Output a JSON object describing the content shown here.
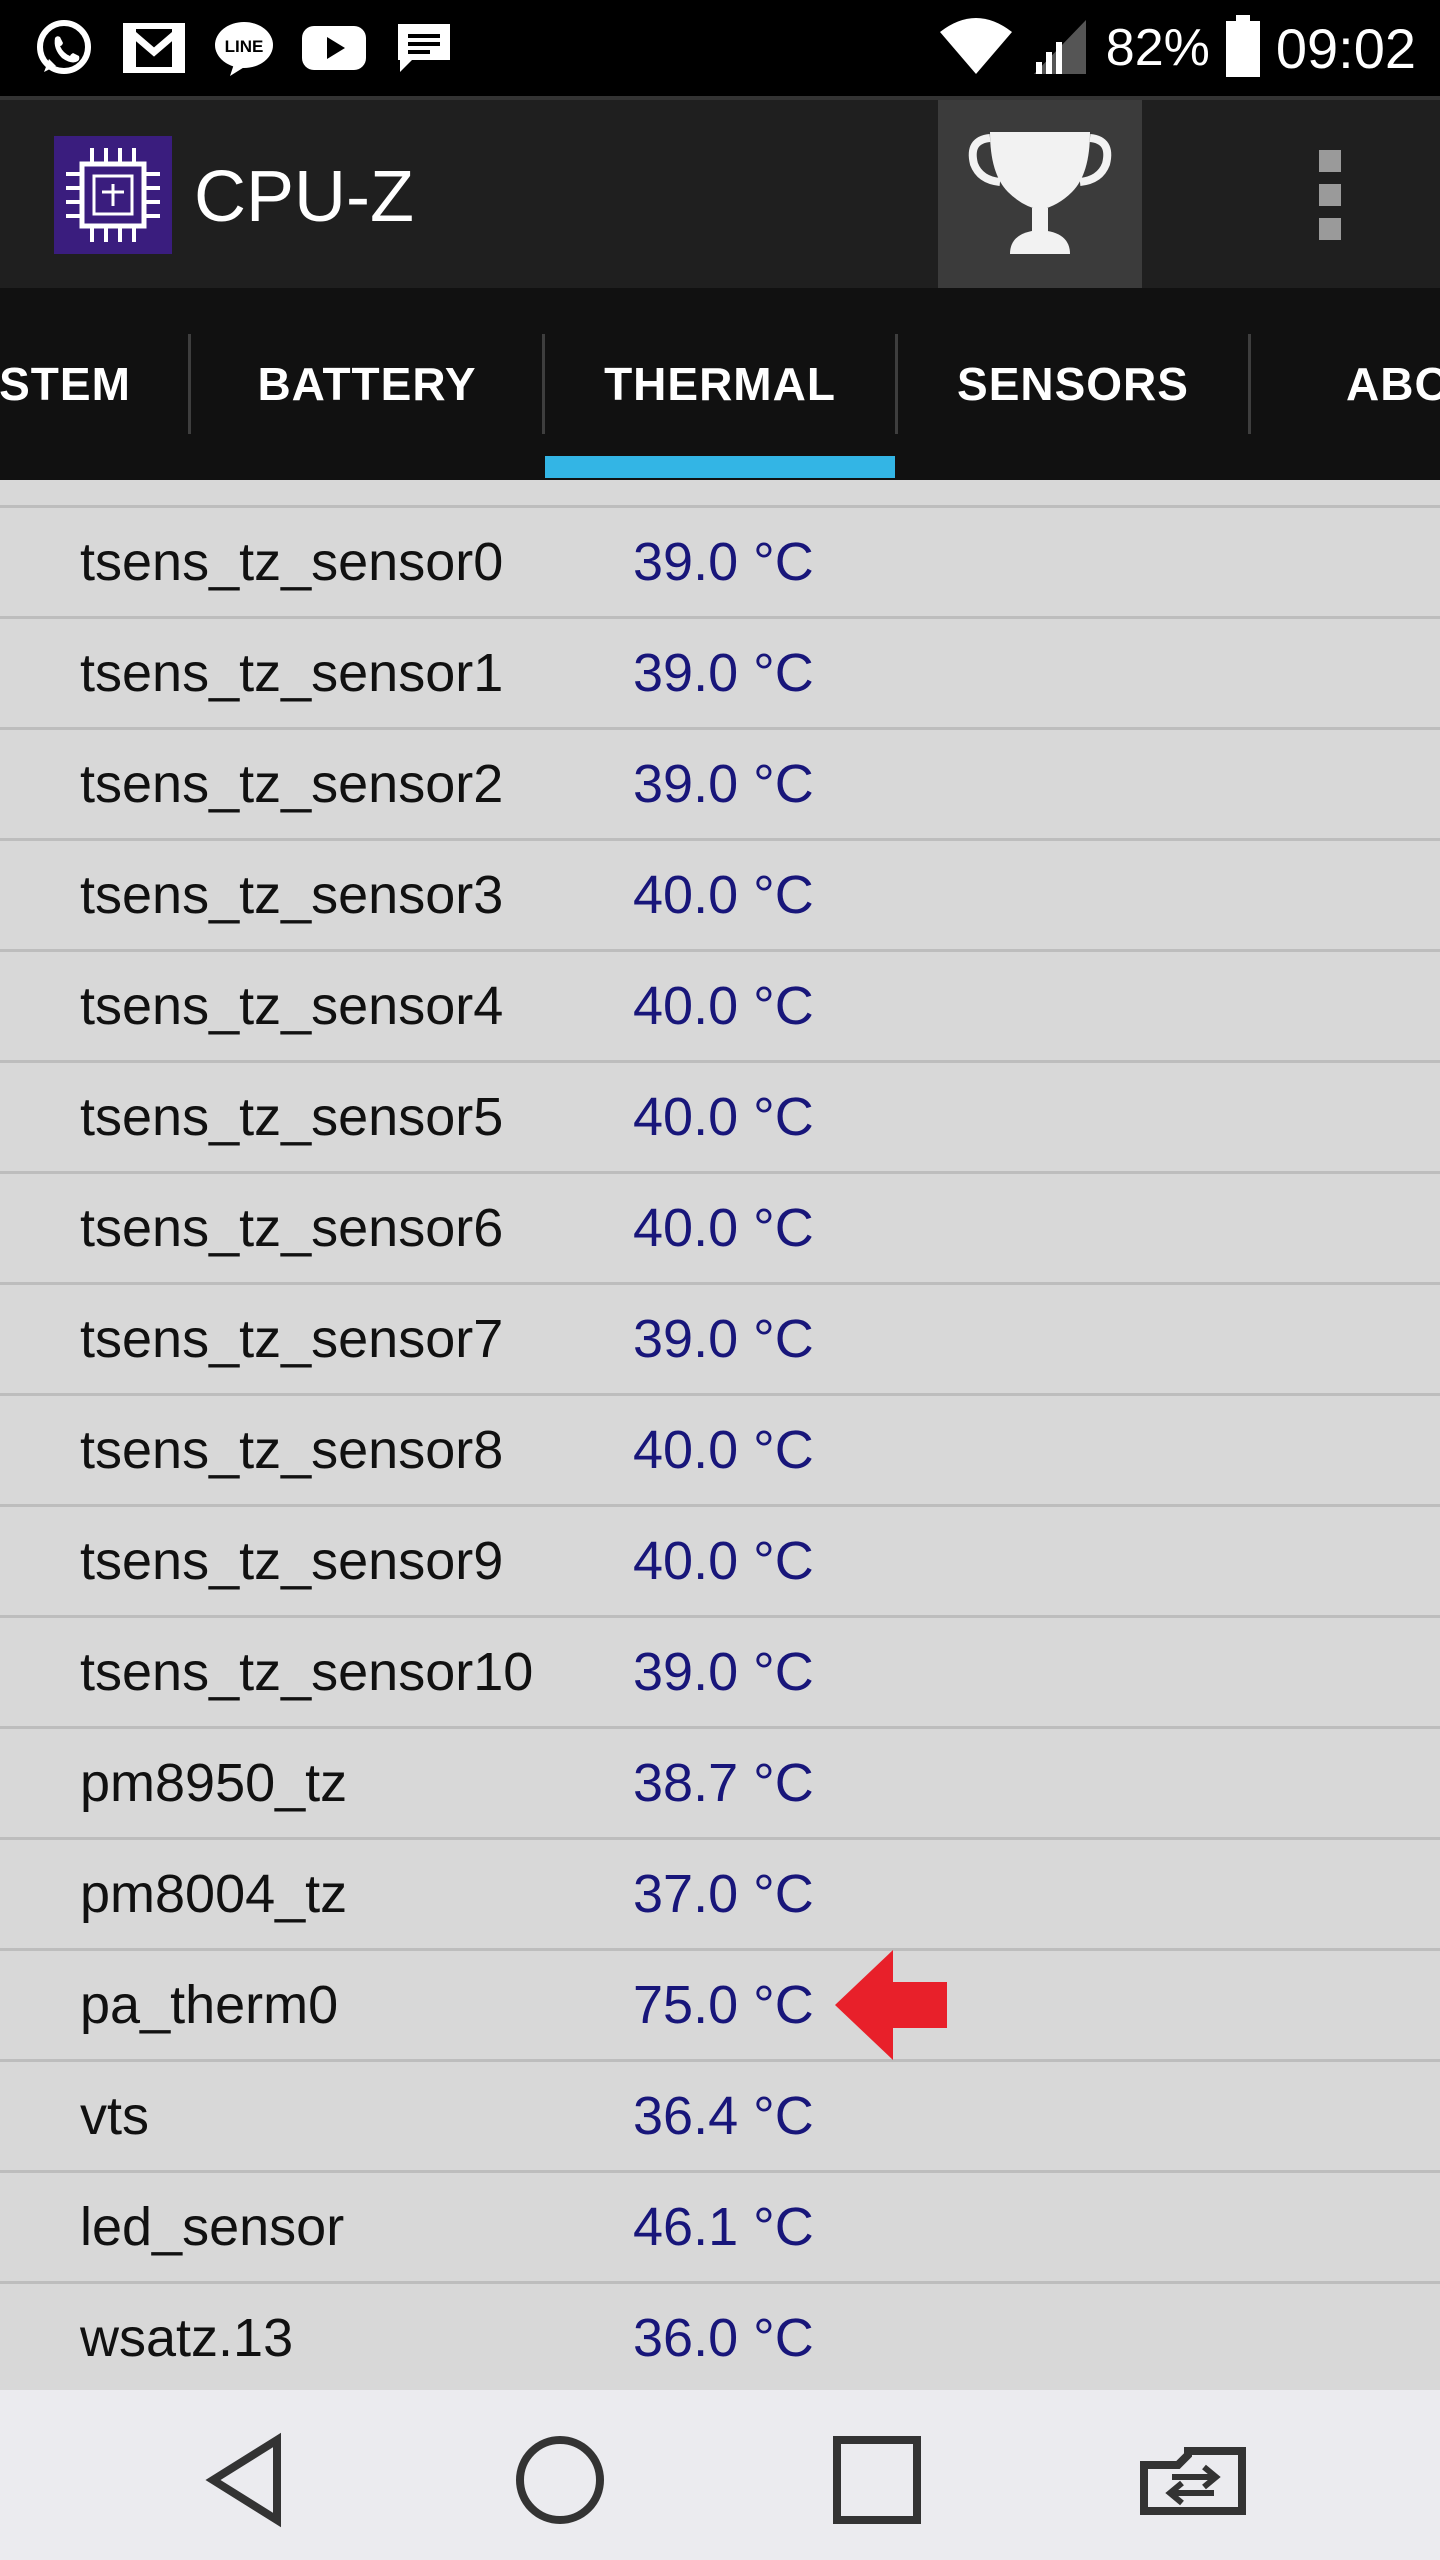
{
  "status_bar": {
    "icons": [
      "whatsapp-icon",
      "gmail-icon",
      "line-icon",
      "youtube-icon",
      "message-icon",
      "wifi-icon",
      "signal-icon",
      "battery-icon"
    ],
    "battery": "82%",
    "time": "09:02"
  },
  "app_bar": {
    "title": "CPU-Z",
    "icons": [
      "cpu-chip-icon",
      "trophy-icon",
      "overflow-menu-icon"
    ]
  },
  "tabs": [
    {
      "label": "STEM"
    },
    {
      "label": "BATTERY"
    },
    {
      "label": "THERMAL",
      "selected": true
    },
    {
      "label": "SENSORS"
    },
    {
      "label": "ABO"
    }
  ],
  "rows": [
    {
      "label": "tsens_tz_sensor0",
      "value": "39.0 °C"
    },
    {
      "label": "tsens_tz_sensor1",
      "value": "39.0 °C"
    },
    {
      "label": "tsens_tz_sensor2",
      "value": "39.0 °C"
    },
    {
      "label": "tsens_tz_sensor3",
      "value": "40.0 °C"
    },
    {
      "label": "tsens_tz_sensor4",
      "value": "40.0 °C"
    },
    {
      "label": "tsens_tz_sensor5",
      "value": "40.0 °C"
    },
    {
      "label": "tsens_tz_sensor6",
      "value": "40.0 °C"
    },
    {
      "label": "tsens_tz_sensor7",
      "value": "39.0 °C"
    },
    {
      "label": "tsens_tz_sensor8",
      "value": "40.0 °C"
    },
    {
      "label": "tsens_tz_sensor9",
      "value": "40.0 °C"
    },
    {
      "label": "tsens_tz_sensor10",
      "value": "39.0 °C"
    },
    {
      "label": "pm8950_tz",
      "value": "38.7 °C"
    },
    {
      "label": "pm8004_tz",
      "value": "37.0 °C"
    },
    {
      "label": "pa_therm0",
      "value": "75.0 °C",
      "highlighted": true
    },
    {
      "label": "vts",
      "value": "36.4 °C"
    },
    {
      "label": "led_sensor",
      "value": "46.1 °C"
    },
    {
      "label": "wsatz.13",
      "value": "36.0 °C"
    }
  ],
  "highlight_color": "#e8202a",
  "accent_color": "#33b5e5",
  "nav_bar": {
    "icons": [
      "back-icon",
      "home-icon",
      "recents-icon",
      "switch-app-icon"
    ]
  }
}
